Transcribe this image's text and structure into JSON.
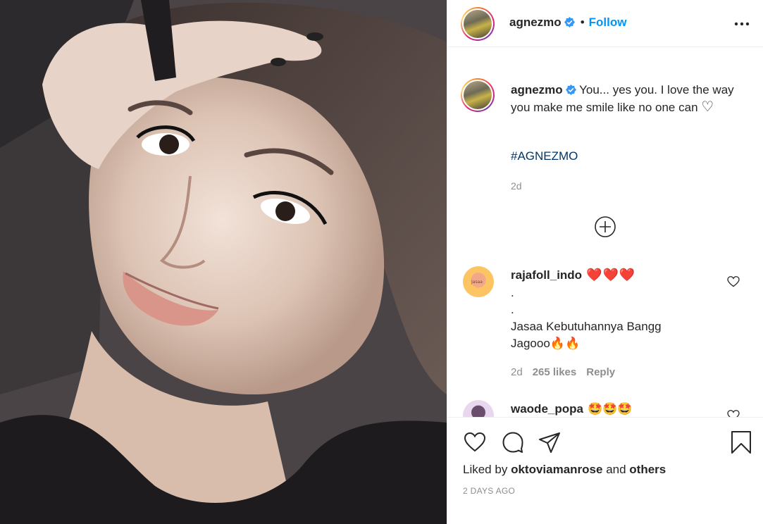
{
  "post": {
    "username": "agnezmo",
    "follow_label": "Follow",
    "separator": "•",
    "caption_text": "You... yes you. I love the way you make me smile like no one can",
    "caption_heart": "♡",
    "hashtag": "#AGNEZMO",
    "caption_time": "2d"
  },
  "comments": [
    {
      "username": "rajafoll_indo",
      "decoration": "❤️❤️❤️",
      "avatar_text": "Jasaa",
      "lines": [
        ".",
        ".",
        "Jasaa Kebutuhannya Bangg",
        "Jagooo🔥🔥"
      ],
      "time": "2d",
      "likes": "265 likes",
      "reply_label": "Reply"
    },
    {
      "username": "waode_popa",
      "decoration": "🤩🤩🤩"
    }
  ],
  "footer": {
    "liked_by_prefix": "Liked by",
    "liked_by_user": "oktoviamanrose",
    "liked_by_and": "and",
    "liked_by_others": "others",
    "date": "2 DAYS AGO"
  },
  "colors": {
    "link_blue": "#0095f6",
    "hashtag_blue": "#00376b",
    "muted_text": "#8e8e8e",
    "border": "#efefef"
  },
  "icons": [
    "verified-badge-icon",
    "more-options-icon",
    "caption-heart-icon",
    "load-more-comments-icon",
    "comment-like-icon",
    "like-icon",
    "comment-icon",
    "share-icon",
    "save-icon"
  ]
}
